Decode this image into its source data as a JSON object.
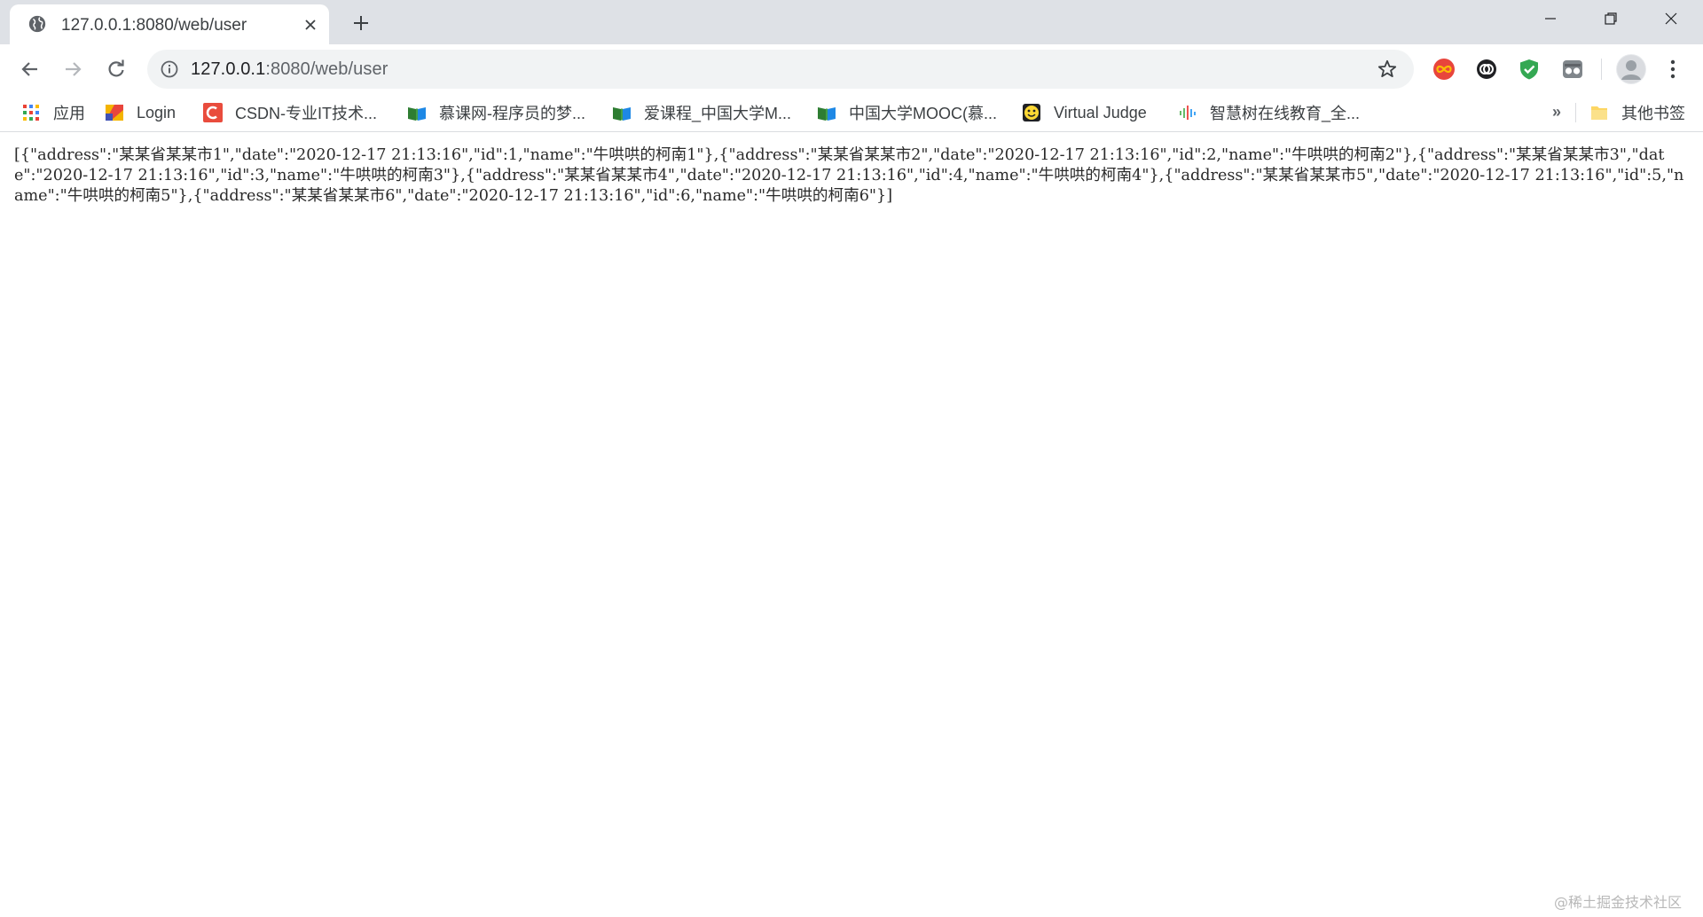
{
  "window": {
    "tab": {
      "title": "127.0.0.1:8080/web/user"
    },
    "controls": {
      "minimize": "minimize-icon",
      "maximize": "restore-icon",
      "close": "close-icon"
    }
  },
  "toolbar": {
    "url": {
      "host": "127.0.0.1",
      "rest": ":8080/web/user"
    }
  },
  "bookmarks": {
    "items": [
      {
        "label": "应用",
        "icon": "apps-grid-icon"
      },
      {
        "label": "Login",
        "icon": "login-icon"
      },
      {
        "label": "CSDN-专业IT技术...",
        "icon": "csdn-icon"
      },
      {
        "label": "慕课网-程序员的梦...",
        "icon": "book-icon"
      },
      {
        "label": "爱课程_中国大学M...",
        "icon": "book-icon"
      },
      {
        "label": "中国大学MOOC(慕...",
        "icon": "book-icon"
      },
      {
        "label": "Virtual Judge",
        "icon": "virtual-judge-icon"
      },
      {
        "label": "智慧树在线教育_全...",
        "icon": "audio-bars-icon"
      }
    ],
    "overflow": "»",
    "other": {
      "label": "其他书签",
      "icon": "folder-icon"
    }
  },
  "page": {
    "body": "[{\"address\":\"某某省某某市1\",\"date\":\"2020-12-17 21:13:16\",\"id\":1,\"name\":\"牛哄哄的柯南1\"},{\"address\":\"某某省某某市2\",\"date\":\"2020-12-17 21:13:16\",\"id\":2,\"name\":\"牛哄哄的柯南2\"},{\"address\":\"某某省某某市3\",\"date\":\"2020-12-17 21:13:16\",\"id\":3,\"name\":\"牛哄哄的柯南3\"},{\"address\":\"某某省某某市4\",\"date\":\"2020-12-17 21:13:16\",\"id\":4,\"name\":\"牛哄哄的柯南4\"},{\"address\":\"某某省某某市5\",\"date\":\"2020-12-17 21:13:16\",\"id\":5,\"name\":\"牛哄哄的柯南5\"},{\"address\":\"某某省某某市6\",\"date\":\"2020-12-17 21:13:16\",\"id\":6,\"name\":\"牛哄哄的柯南6\"}]",
    "watermark": "@稀土掘金技术社区"
  },
  "colors": {
    "tabstrip": "#dee1e6",
    "omnibox": "#f1f3f4",
    "icon_gray": "#5f6368",
    "text": "#3c4043"
  }
}
